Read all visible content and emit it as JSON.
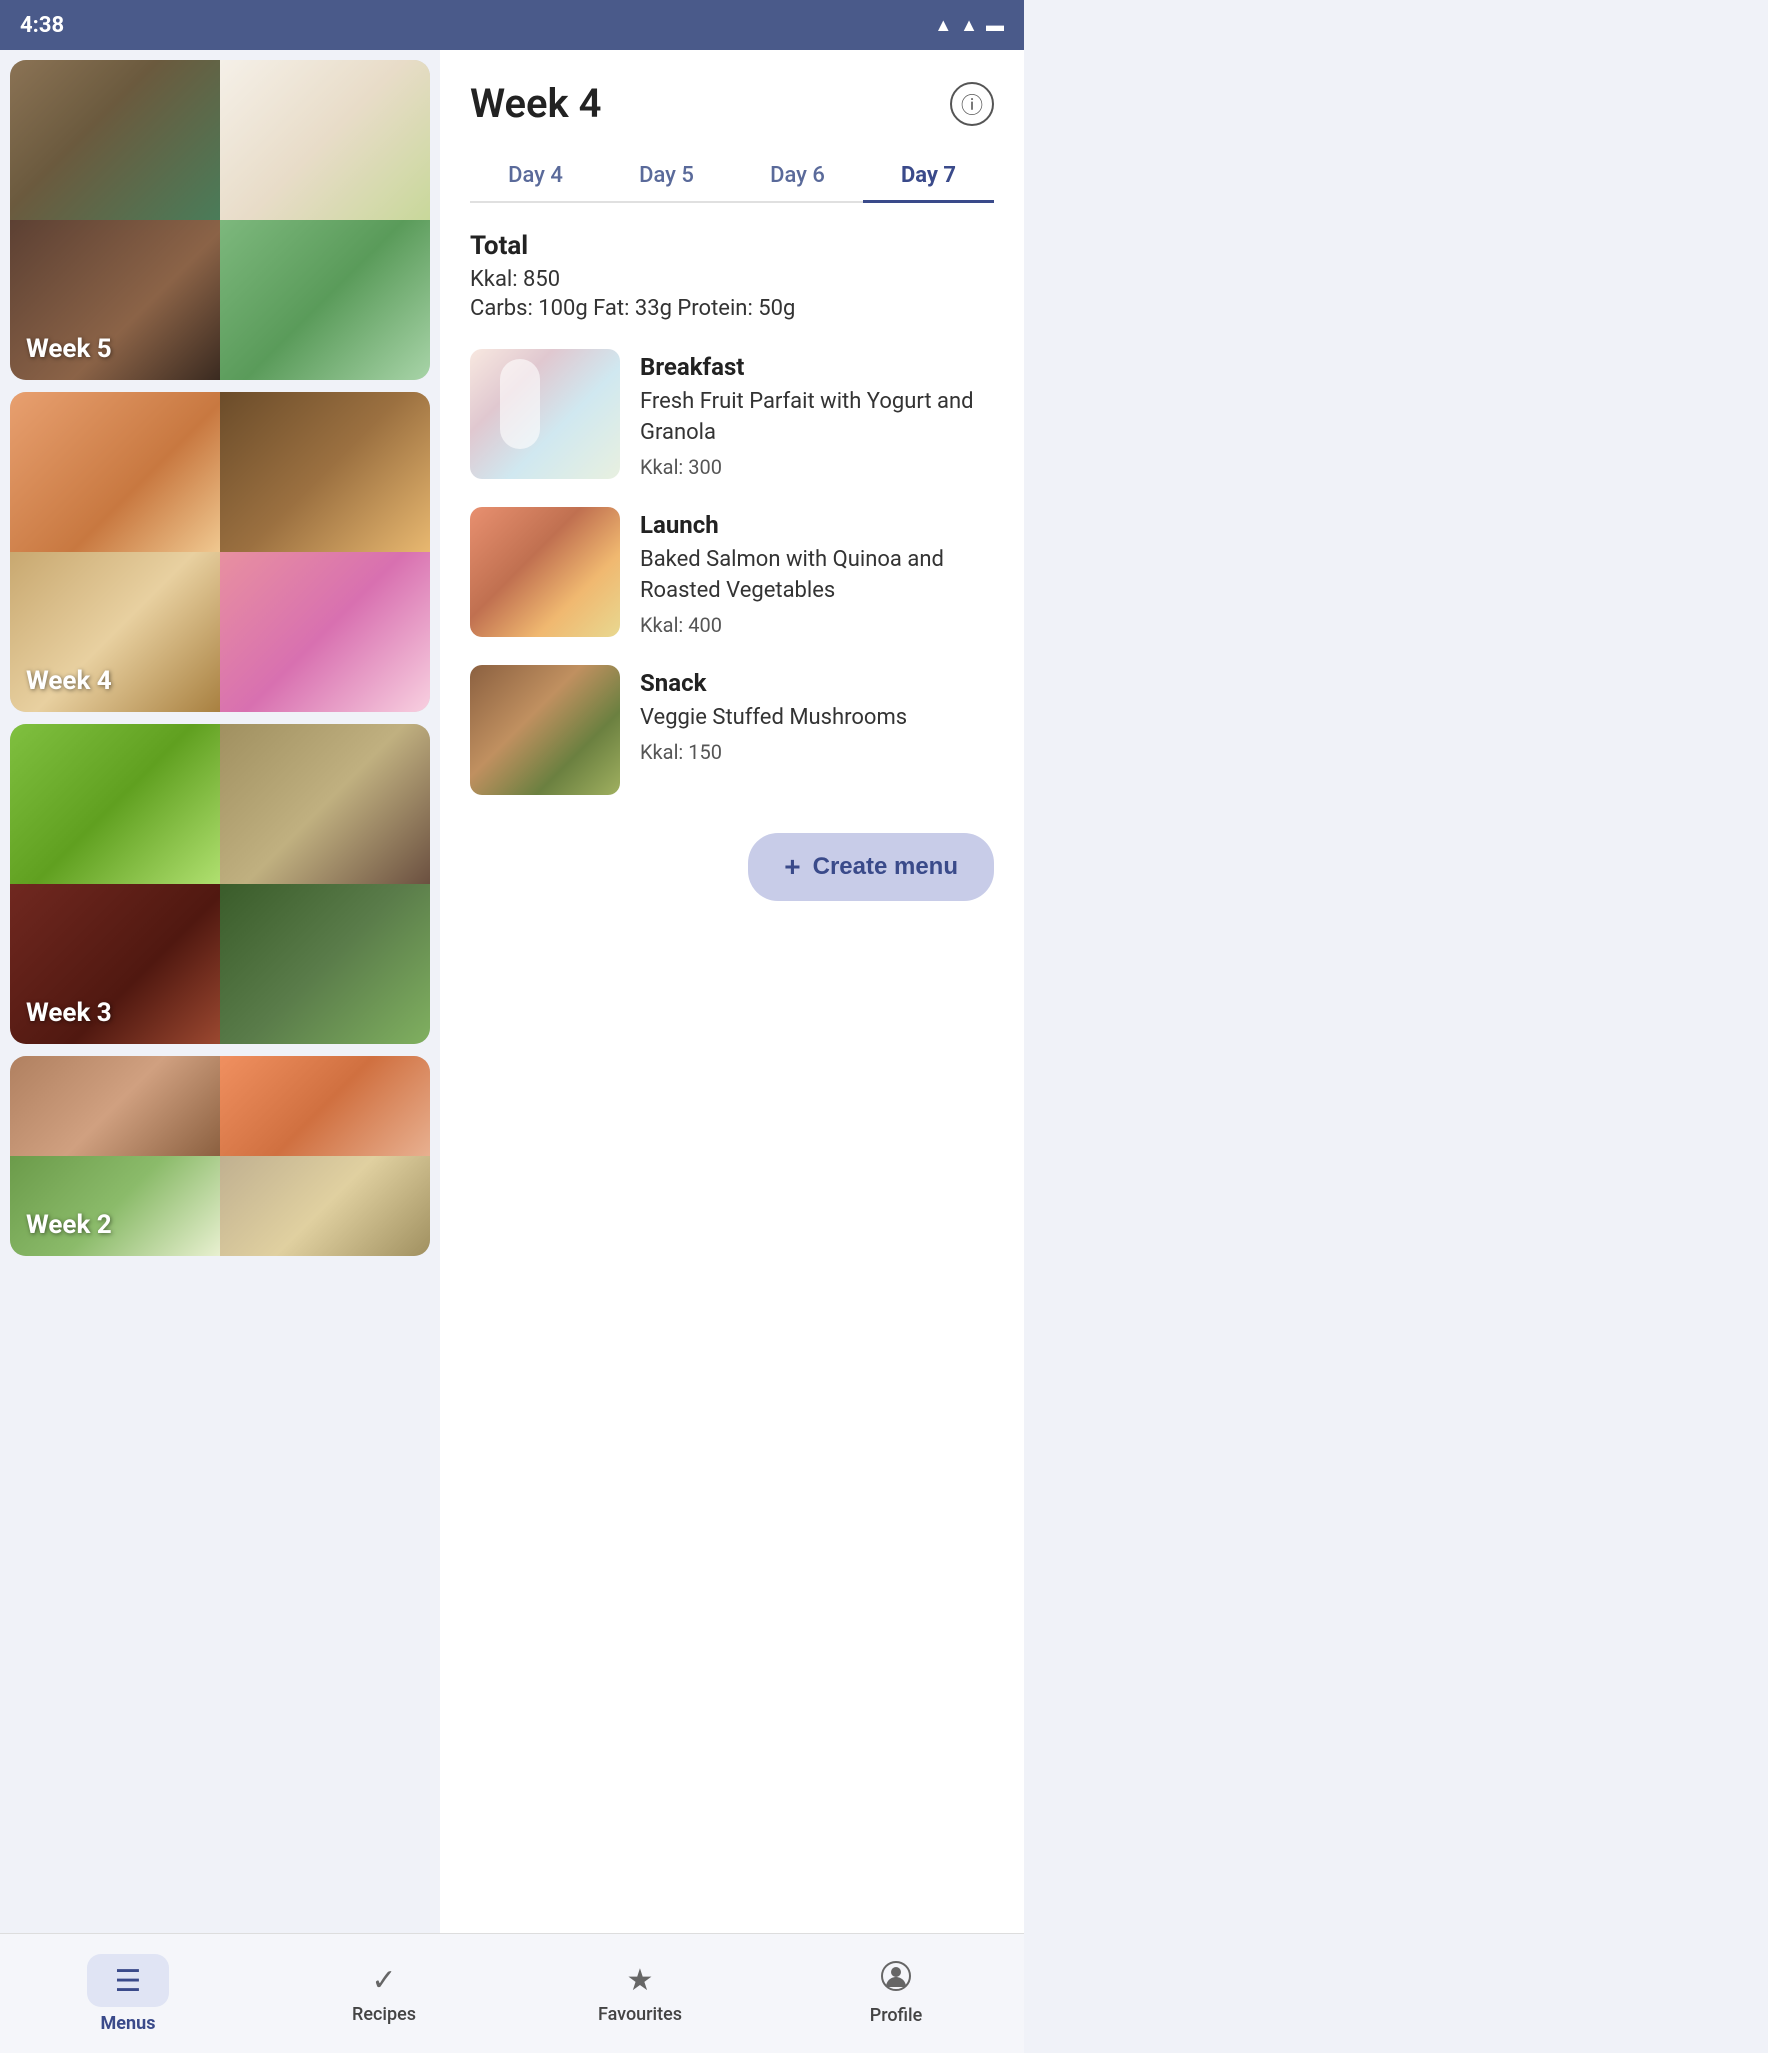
{
  "statusBar": {
    "time": "4:38",
    "icons": [
      "wifi",
      "signal",
      "battery"
    ]
  },
  "header": {
    "weekTitle": "Week 4",
    "infoIcon": "ℹ"
  },
  "tabs": [
    {
      "label": "Day 4",
      "active": false
    },
    {
      "label": "Day 5",
      "active": false
    },
    {
      "label": "Day 6",
      "active": false
    },
    {
      "label": "Day 7",
      "active": true
    }
  ],
  "totals": {
    "title": "Total",
    "kkal": "Kkal: 850",
    "macros": "Carbs: 100g  Fat: 33g  Protein: 50g"
  },
  "meals": [
    {
      "type": "Breakfast",
      "name": "Fresh Fruit Parfait with Yogurt and Granola",
      "kkal": "Kkal: 300"
    },
    {
      "type": "Launch",
      "name": "Baked Salmon with Quinoa and Roasted Vegetables",
      "kkal": "Kkal: 400"
    },
    {
      "type": "Snack",
      "name": "Veggie Stuffed Mushrooms",
      "kkal": "Kkal: 150"
    }
  ],
  "weekCards": [
    {
      "label": "Week 5"
    },
    {
      "label": "Week 4"
    },
    {
      "label": "Week 3"
    },
    {
      "label": "Week 2"
    }
  ],
  "createMenu": {
    "label": "Create menu",
    "plus": "+"
  },
  "bottomNav": [
    {
      "label": "Menus",
      "icon": "☰",
      "active": true
    },
    {
      "label": "Recipes",
      "icon": "✓",
      "active": false
    },
    {
      "label": "Favourites",
      "icon": "★",
      "active": false
    },
    {
      "label": "Profile",
      "icon": "👤",
      "active": false
    }
  ]
}
